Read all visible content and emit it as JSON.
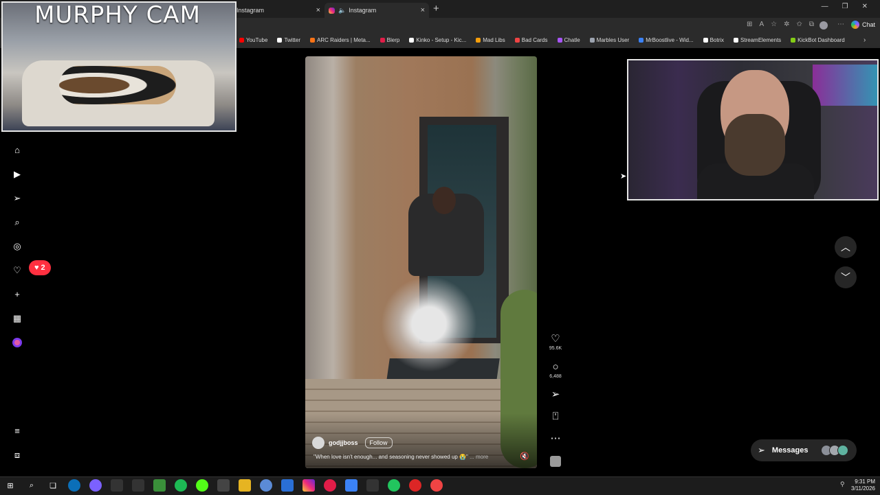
{
  "browser": {
    "tabs": [
      {
        "label": "Instagram",
        "close": "×"
      },
      {
        "label": "Instagram",
        "close": "×"
      }
    ],
    "new_tab": "+",
    "window_controls": [
      "—",
      "❐",
      "✕"
    ],
    "chat_label": "Chat",
    "bookmarks": [
      {
        "label": "YouTube",
        "color": "#ff0000"
      },
      {
        "label": "Twitter",
        "color": "#ffffff"
      },
      {
        "label": "ARC Raiders | Meta...",
        "color": "#f97316"
      },
      {
        "label": "Blerp",
        "color": "#e11d48"
      },
      {
        "label": "Kinko - Setup - Kic...",
        "color": "#ffffff"
      },
      {
        "label": "Mad Libs",
        "color": "#f59e0b"
      },
      {
        "label": "Bad Cards",
        "color": "#ef4444"
      },
      {
        "label": "Chatle",
        "color": "#a855f7"
      },
      {
        "label": "Marbles User",
        "color": "#9ca3af"
      },
      {
        "label": "MrBoostlive - Wid...",
        "color": "#3b82f6"
      },
      {
        "label": "Botrix",
        "color": "#ffffff"
      },
      {
        "label": "StreamElements",
        "color": "#ffffff"
      },
      {
        "label": "KickBot Dashboard",
        "color": "#84cc16"
      }
    ]
  },
  "overlay": {
    "murphy_title": "MURPHY CAM"
  },
  "sidebar": {
    "notifications_count": "2"
  },
  "post": {
    "username": "godjjboss",
    "follow_label": "Follow",
    "caption": "\"When love isn't enough... and seasoning never showed up 😭\"",
    "more_label": "... more",
    "likes": "95.6K",
    "comments": "6,488"
  },
  "messages": {
    "label": "Messages"
  },
  "taskbar": {
    "time": "9:31 PM",
    "date": "3/11/2026"
  },
  "colors": {
    "notification_red": "#ff3040",
    "background": "#000000"
  }
}
